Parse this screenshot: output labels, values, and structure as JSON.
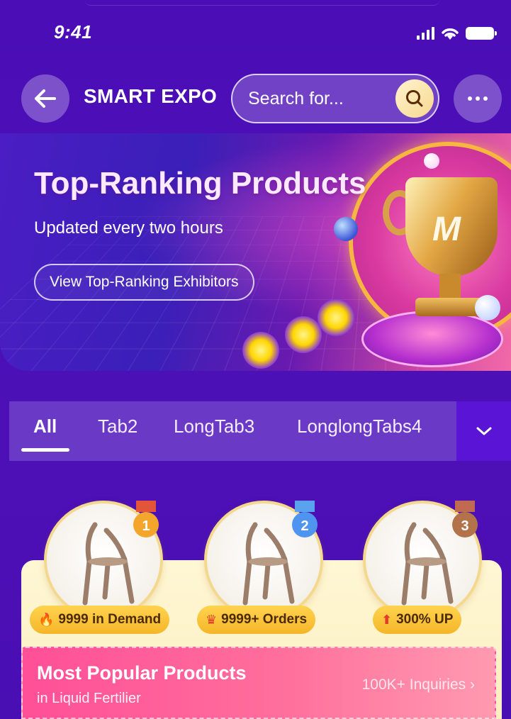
{
  "status_bar": {
    "time": "9:41"
  },
  "header": {
    "title": "SMART EXPO",
    "search_placeholder": "Search for..."
  },
  "banner": {
    "title": "Top-Ranking Products",
    "subtitle": "Updated every two hours",
    "button_label": "View Top-Ranking Exhibitors",
    "trophy_logo": "M"
  },
  "tabs": [
    {
      "label": "All",
      "active": true
    },
    {
      "label": "Tab2",
      "active": false
    },
    {
      "label": "LongTab3",
      "active": false
    },
    {
      "label": "LonglongTabs4",
      "active": false
    }
  ],
  "ranking": [
    {
      "rank": "1",
      "medal": "gold-medal-icon",
      "badge_icon": "flame-icon",
      "badge_text": "9999 in Demand",
      "medal_color": "#f4a52b"
    },
    {
      "rank": "2",
      "medal": "silver-medal-icon",
      "badge_icon": "crown-icon",
      "badge_text": "9999+ Orders",
      "medal_color": "#4f95f0"
    },
    {
      "rank": "3",
      "medal": "bronze-medal-icon",
      "badge_icon": "up-arrow-icon",
      "badge_text": "300% UP",
      "medal_color": "#b2734a"
    }
  ],
  "popular": {
    "title": "Most Popular Products",
    "subtitle": "in Liquid Fertilier",
    "inquiries": "100K+ Inquiries"
  },
  "colors": {
    "background": "#4a0eb5",
    "tab_bar": "#6a3ac7",
    "card": "#fff7d4",
    "badge": "#ffd34f",
    "popular": "#ff4f98"
  }
}
